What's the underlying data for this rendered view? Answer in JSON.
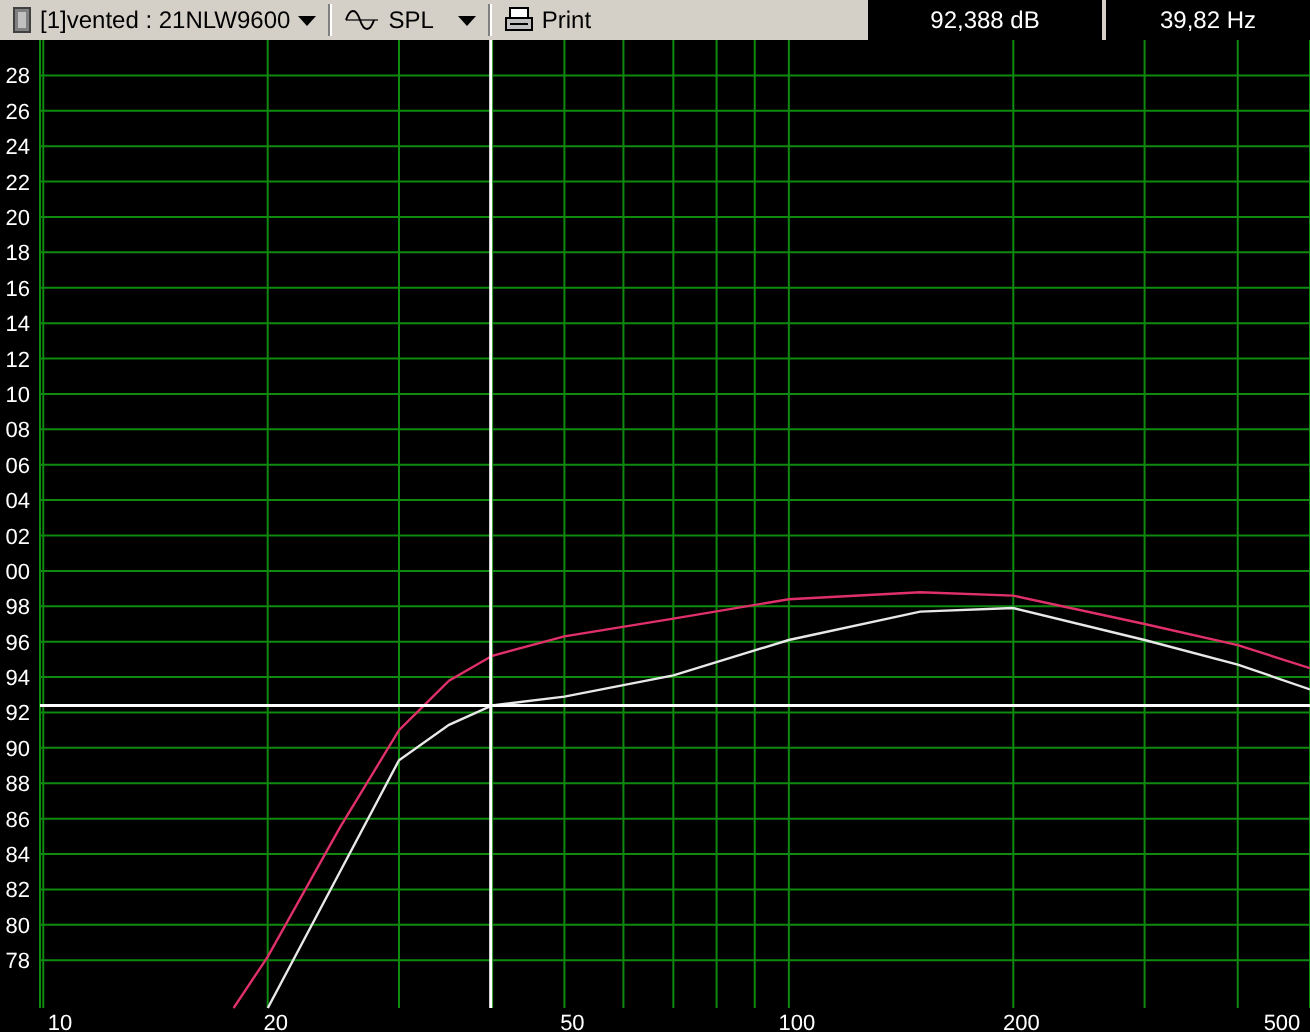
{
  "toolbar": {
    "curve_select": {
      "label": "[1]vented : 21NLW9600"
    },
    "mode_select": {
      "label": "SPL"
    },
    "print_button": {
      "label": "Print"
    }
  },
  "readouts": [
    {
      "text": "92,388 dB"
    },
    {
      "text": "39,82 Hz"
    }
  ],
  "plot": {
    "y_axis_labels": [
      "28",
      "26",
      "24",
      "22",
      "20",
      "18",
      "16",
      "14",
      "12",
      "10",
      "08",
      "06",
      "04",
      "02",
      "00",
      "98",
      "96",
      "94",
      "92",
      "90",
      "88",
      "86",
      "84",
      "82",
      "80",
      "78"
    ],
    "x_axis_labels": [
      "10",
      "20",
      "50",
      "100",
      "200",
      "500"
    ]
  }
}
